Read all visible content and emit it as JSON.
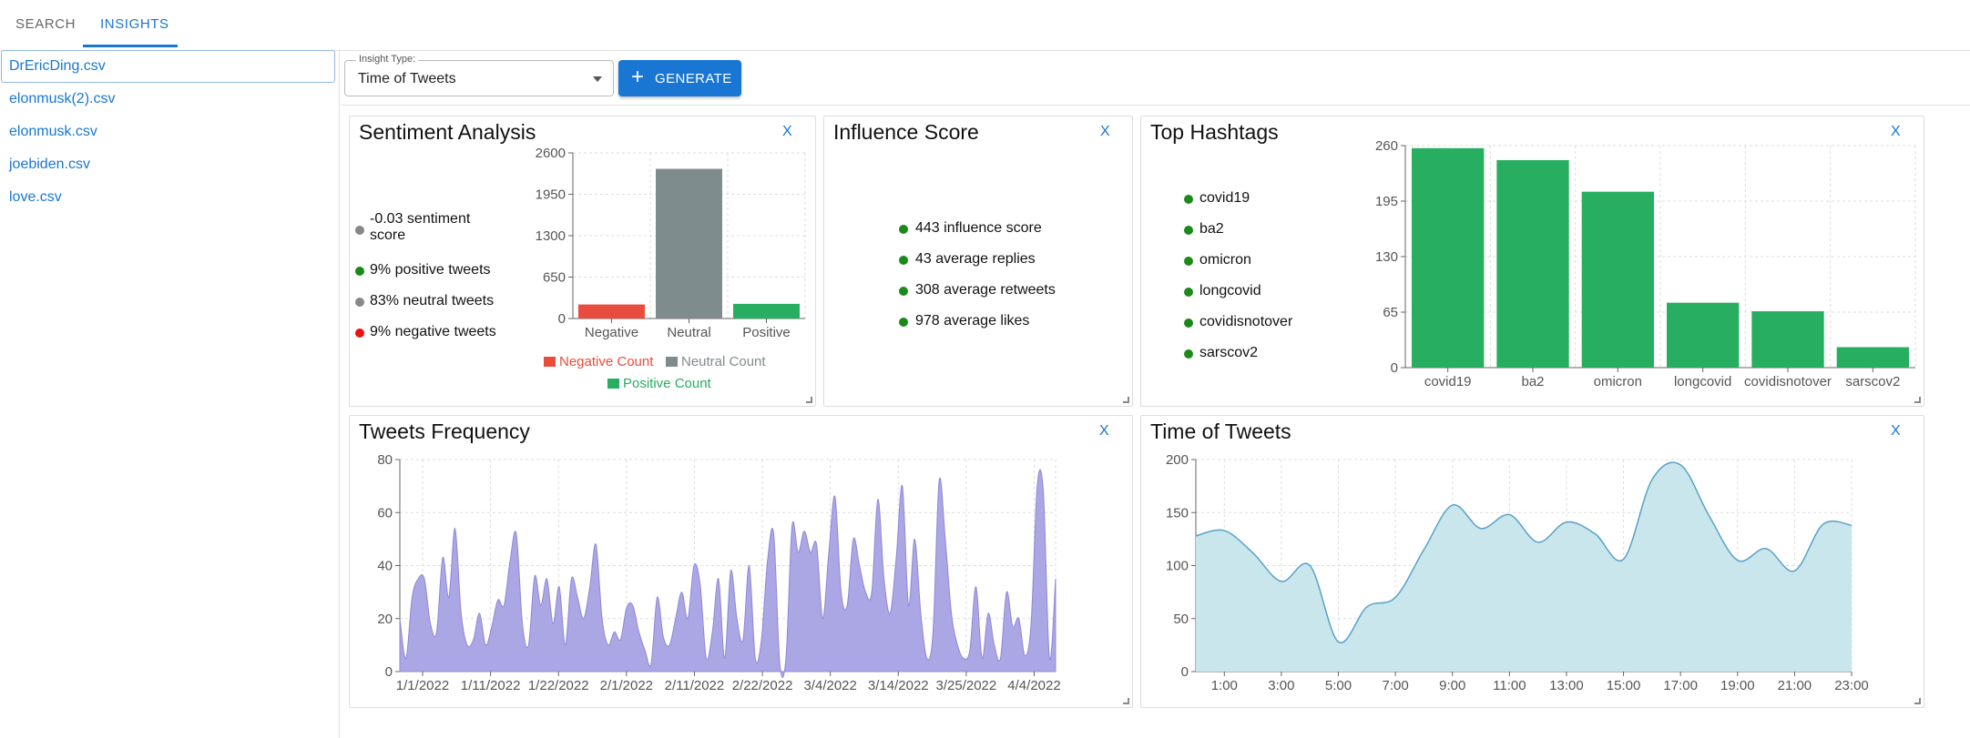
{
  "tabs": [
    {
      "label": "SEARCH"
    },
    {
      "label": "INSIGHTS"
    }
  ],
  "files": [
    "DrEricDing.csv",
    "elonmusk(2).csv",
    "elonmusk.csv",
    "joebiden.csv",
    "love.csv"
  ],
  "controls": {
    "select_label": "Insight Type:",
    "select_value": "Time of Tweets",
    "generate_label": "GENERATE"
  },
  "close_label": "X",
  "sentiment": {
    "title": "Sentiment Analysis",
    "stats": [
      {
        "text": "-0.03 sentiment",
        "text2": "score",
        "color": "#888888"
      },
      {
        "text": "9% positive tweets",
        "color": "#1a8a1a"
      },
      {
        "text": "83% neutral tweets",
        "color": "#888888"
      },
      {
        "text": "9% negative tweets",
        "color": "#ee1111"
      }
    ]
  },
  "influence": {
    "title": "Influence Score",
    "stats": [
      "443 influence score",
      "43 average replies",
      "308 average retweets",
      "978 average likes"
    ]
  },
  "hashtags": {
    "title": "Top Hashtags",
    "list": [
      "covid19",
      "ba2",
      "omicron",
      "longcovid",
      "covidisnotover",
      "sarscov2"
    ]
  },
  "frequency": {
    "title": "Tweets Frequency"
  },
  "time": {
    "title": "Time of Tweets"
  },
  "chart_data": [
    {
      "type": "bar",
      "categories": [
        "Negative",
        "Neutral",
        "Positive"
      ],
      "values": [
        220,
        2350,
        230
      ],
      "ylim": [
        0,
        2600
      ],
      "yticks": [
        0,
        650,
        1300,
        1950,
        2600
      ],
      "colors": [
        "#e74c3c",
        "#7f8c8d",
        "#27ae60"
      ],
      "legend": [
        "Negative Count",
        "Neutral Count",
        "Positive Count"
      ],
      "grid": true
    },
    {
      "type": "bar",
      "categories": [
        "covid19",
        "ba2",
        "omicron",
        "longcovid",
        "covidisnotover",
        "sarscov2"
      ],
      "values": [
        257,
        243,
        206,
        76,
        66,
        24
      ],
      "ylim": [
        0,
        260
      ],
      "yticks": [
        0,
        65,
        130,
        195,
        260
      ],
      "color": "#27ae60",
      "grid": true
    },
    {
      "type": "area",
      "xticks": [
        "1/1/2022",
        "1/11/2022",
        "1/22/2022",
        "2/1/2022",
        "2/11/2022",
        "2/22/2022",
        "3/4/2022",
        "3/14/2022",
        "3/25/2022",
        "4/4/2022"
      ],
      "ylim": [
        0,
        80
      ],
      "yticks": [
        0,
        20,
        40,
        60,
        80
      ],
      "color": "#aba6e4",
      "values": [
        20,
        5,
        28,
        35,
        35,
        18,
        15,
        43,
        28,
        54,
        22,
        10,
        12,
        22,
        10,
        17,
        27,
        25,
        42,
        52,
        18,
        10,
        36,
        25,
        35,
        18,
        32,
        10,
        35,
        28,
        20,
        32,
        48,
        20,
        10,
        15,
        12,
        24,
        25,
        15,
        8,
        3,
        28,
        13,
        10,
        20,
        30,
        20,
        40,
        33,
        5,
        15,
        35,
        5,
        38,
        20,
        12,
        40,
        5,
        12,
        42,
        52,
        3,
        5,
        55,
        45,
        53,
        45,
        48,
        20,
        45,
        66,
        30,
        25,
        50,
        40,
        30,
        30,
        65,
        35,
        22,
        43,
        70,
        25,
        50,
        22,
        5,
        15,
        72,
        50,
        22,
        10,
        5,
        8,
        32,
        5,
        22,
        10,
        5,
        30,
        17,
        20,
        6,
        18,
        70,
        68,
        5,
        35
      ],
      "grid": true
    },
    {
      "type": "area",
      "xticks": [
        "1:00",
        "3:00",
        "5:00",
        "7:00",
        "9:00",
        "11:00",
        "13:00",
        "15:00",
        "17:00",
        "19:00",
        "21:00",
        "23:00"
      ],
      "ylim": [
        0,
        200
      ],
      "yticks": [
        0,
        50,
        100,
        150,
        200
      ],
      "color": "#c9e6ec",
      "stroke": "#5aa0c8",
      "values": [
        {
          "h": 0,
          "v": 128
        },
        {
          "h": 1,
          "v": 133
        },
        {
          "h": 2,
          "v": 112
        },
        {
          "h": 3,
          "v": 85
        },
        {
          "h": 4,
          "v": 100
        },
        {
          "h": 5,
          "v": 28
        },
        {
          "h": 6,
          "v": 61
        },
        {
          "h": 7,
          "v": 70
        },
        {
          "h": 8,
          "v": 115
        },
        {
          "h": 9,
          "v": 157
        },
        {
          "h": 10,
          "v": 135
        },
        {
          "h": 11,
          "v": 148
        },
        {
          "h": 12,
          "v": 122
        },
        {
          "h": 13,
          "v": 141
        },
        {
          "h": 14,
          "v": 130
        },
        {
          "h": 15,
          "v": 106
        },
        {
          "h": 16,
          "v": 181
        },
        {
          "h": 17,
          "v": 195
        },
        {
          "h": 18,
          "v": 147
        },
        {
          "h": 19,
          "v": 105
        },
        {
          "h": 20,
          "v": 116
        },
        {
          "h": 21,
          "v": 95
        },
        {
          "h": 22,
          "v": 139
        },
        {
          "h": 23,
          "v": 138
        }
      ],
      "grid": true
    }
  ]
}
